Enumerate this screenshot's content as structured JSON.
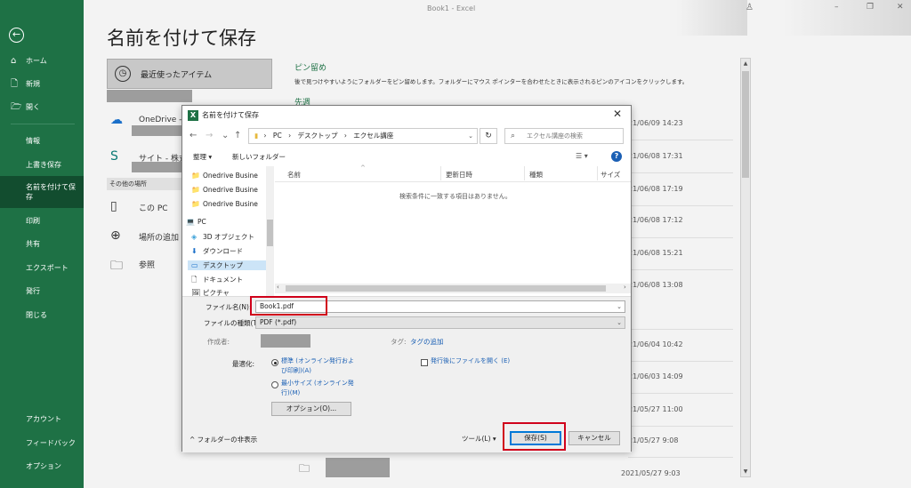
{
  "titlebar": {
    "title": "Book1 - Excel",
    "minimize": "–",
    "restore": "❐",
    "close": "✕",
    "person_icon": "person-icon"
  },
  "sidebar": {
    "back_icon": "back-arrow-icon",
    "items": [
      {
        "icon": "⌂",
        "label": "ホーム"
      },
      {
        "icon": "🗋",
        "label": "新規"
      },
      {
        "icon": "🗁",
        "label": "開く"
      },
      {
        "label": "情報"
      },
      {
        "label": "上書き保存"
      },
      {
        "label": "名前を付けて保存"
      },
      {
        "label": "印刷"
      },
      {
        "label": "共有"
      },
      {
        "label": "エクスポート"
      },
      {
        "label": "発行"
      },
      {
        "label": "閉じる"
      },
      {
        "label": "アカウント"
      },
      {
        "label": "フィードバック"
      },
      {
        "label": "オプション"
      }
    ]
  },
  "page": {
    "title": "名前を付けて保存",
    "recent": "最近使ったアイテム",
    "onedrive": "OneDrive -",
    "site": "サイト - 株式",
    "other_places": "その他の場所",
    "this_pc": "この PC",
    "add_place": "場所の追加",
    "browse": "参照",
    "pinned_title": "ピン留め",
    "pinned_desc": "後で見つけやすいようにフォルダーをピン留めします。フォルダーにマウス ポインターを合わせたときに表示されるピンのアイコンをクリックします。",
    "prev_title": "先週",
    "dates": [
      "21/06/09 14:23",
      "21/06/08 17:31",
      "21/06/08 17:19",
      "21/06/08 17:12",
      "21/06/08 15:21",
      "21/06/08 13:08",
      "21/06/04 10:42",
      "21/06/03 14:09",
      "21/05/27 11:00",
      "21/05/27 9:08"
    ],
    "bottom_date": "2021/05/27 9:03"
  },
  "dialog": {
    "title": "名前を付けて保存",
    "close": "✕",
    "nav": {
      "back": "←",
      "forward": "→",
      "dropdown": "⌄",
      "up": "↑"
    },
    "path": [
      "PC",
      "デスクトップ",
      "エクセル講座"
    ],
    "path_sep": "›",
    "search_placeholder": "エクセル講座の検索",
    "organize": "整理 ▾",
    "new_folder": "新しいフォルダー",
    "help": "?",
    "tree": [
      {
        "icon": "📁",
        "label": "Onedrive Busine"
      },
      {
        "icon": "📁",
        "label": "Onedrive Busine"
      },
      {
        "icon": "📁",
        "label": "Onedrive Busine"
      },
      {
        "icon": "💻",
        "label": "PC"
      },
      {
        "icon": "◈",
        "label": "3D オブジェクト"
      },
      {
        "icon": "⬇",
        "label": "ダウンロード"
      },
      {
        "icon": "▭",
        "label": "デスクトップ"
      },
      {
        "icon": "🗋",
        "label": "ドキュメント"
      },
      {
        "icon": "🖼",
        "label": "ピクチャ"
      }
    ],
    "columns": [
      "名前",
      "更新日時",
      "種類",
      "サイズ"
    ],
    "empty_message": "検索条件に一致する項目はありません。",
    "file_name_label": "ファイル名(N):",
    "file_name_value": "Book1.pdf",
    "file_type_label": "ファイルの種類(T):",
    "file_type_value": "PDF (*.pdf)",
    "author_label": "作成者:",
    "tag_label": "タグ:",
    "tag_link": "タグの追加",
    "optimize_label": "最適化:",
    "opt_standard": "標準 (オンライン発行およ び印刷)(A)",
    "opt_min": "最小サイズ (オンライン発 行)(M)",
    "open_after": "発行後にファイルを開く (E)",
    "options_button": "オプション(O)...",
    "hide_folders": "フォルダーの非表示",
    "tools": "ツール(L)",
    "save": "保存(S)",
    "cancel": "キャンセル"
  },
  "colors": {
    "excel_green": "#1e7145",
    "highlight": "#d0021b",
    "link": "#1a5fb4"
  }
}
